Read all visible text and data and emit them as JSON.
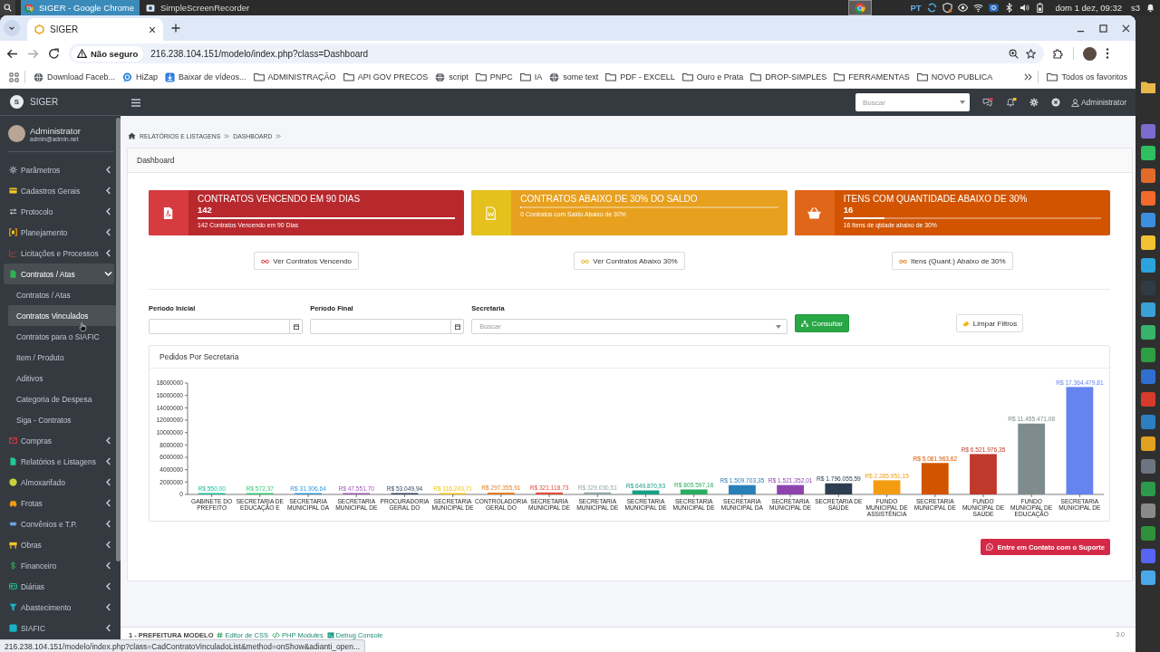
{
  "os_bar": {
    "windows": [
      {
        "label": "SIGER - Google Chrome",
        "selected": true
      },
      {
        "label": "SimpleScreenRecorder",
        "selected": false
      }
    ],
    "language": "PT",
    "clock": "dom 1 dez, 09:32",
    "workspace": "s3"
  },
  "browser": {
    "tabs": [
      {
        "label": "SIGER",
        "selected": true
      }
    ],
    "security": "Não seguro",
    "url": "216.238.104.151/modelo/index.php?class=Dashboard",
    "bookmarks": [
      {
        "kind": "globe",
        "label": "Download Faceb..."
      },
      {
        "kind": "chat",
        "label": "HiZap"
      },
      {
        "kind": "download",
        "label": "Baixar de vídeos..."
      },
      {
        "kind": "folder",
        "label": "ADMINISTRAÇÃO"
      },
      {
        "kind": "folder",
        "label": "API GOV PRECOS"
      },
      {
        "kind": "globe",
        "label": "script"
      },
      {
        "kind": "folder",
        "label": "PNPC"
      },
      {
        "kind": "folder",
        "label": "IA"
      },
      {
        "kind": "globe",
        "label": "some text"
      },
      {
        "kind": "folder",
        "label": "PDF - EXCELL"
      },
      {
        "kind": "folder",
        "label": "Ouro e Prata"
      },
      {
        "kind": "folder",
        "label": "DROP-SIMPLES"
      },
      {
        "kind": "folder",
        "label": "FERRAMENTAS"
      },
      {
        "kind": "folder",
        "label": "NOVO PUBLICA"
      }
    ],
    "all_bookmarks": "Todos os favoritos",
    "status_url": "216.238.104.151/modelo/index.php?class=CadContratoVinculadoList&method=onShow&adianti_open..."
  },
  "sidebar": {
    "brand": "SIGER",
    "brand_initial": "S",
    "user": {
      "name": "Administrator",
      "email": "admin@admin.net"
    },
    "menu": [
      {
        "label": "Parâmetros",
        "expanded": false
      },
      {
        "label": "Cadastros Gerais",
        "expanded": false
      },
      {
        "label": "Protocolo",
        "expanded": false
      },
      {
        "label": "Planejamento",
        "expanded": false
      },
      {
        "label": "Licitações e Processos",
        "expanded": false
      },
      {
        "label": "Contratos / Atas",
        "expanded": true,
        "children": [
          {
            "label": "Contratos / Atas",
            "selected": false
          },
          {
            "label": "Contratos Vinculados",
            "selected": true
          },
          {
            "label": "Contratos para o SIAFIC",
            "selected": false
          },
          {
            "label": "Item / Produto",
            "selected": false
          },
          {
            "label": "Aditivos",
            "selected": false
          },
          {
            "label": "Categoria de Despesa",
            "selected": false
          },
          {
            "label": "Siga - Contratos",
            "selected": false
          }
        ]
      },
      {
        "label": "Compras",
        "expanded": false
      },
      {
        "label": "Relatórios e Listagens",
        "expanded": false
      },
      {
        "label": "Almoxarifado",
        "expanded": false
      },
      {
        "label": "Frotas",
        "expanded": false
      },
      {
        "label": "Convênios e T.P.",
        "expanded": false
      },
      {
        "label": "Obras",
        "expanded": false
      },
      {
        "label": "Financeiro",
        "expanded": false
      },
      {
        "label": "Diárias",
        "expanded": false
      },
      {
        "label": "Abastecimento",
        "expanded": false
      },
      {
        "label": "SIAFIC",
        "expanded": false
      }
    ]
  },
  "topbar": {
    "search": {
      "placeholder": "Buscar"
    },
    "user": "Administrator"
  },
  "breadcrumb": [
    "RELATÓRIOS E LISTAGENS",
    "DASHBOARD"
  ],
  "panel": {
    "title": "Dashboard",
    "info_boxes": [
      {
        "title": "CONTRATOS VENCENDO EM 90 DIAS",
        "count": "142",
        "level": 1,
        "description": "142 Contratos Vencendo em 90 Dias",
        "color": "#b8292d",
        "action": "Ver Contratos Vencendo"
      },
      {
        "title": "CONTRATOS ABAIXO DE 30% DO SALDO",
        "level": 0,
        "description": "0 Contratos com Saldo Abaixo de 30%",
        "color": "#e8a01f",
        "action": "Ver Contratos Abaixo 30%"
      },
      {
        "title": "ITENS COM QUANTIDADE ABAIXO DE 30%",
        "count": "16",
        "level": 0.16,
        "description": "16 Itens de qtdade abaixo de 30%",
        "color": "#d25400",
        "action": "Itens (Quant.) Abaixo de 30%"
      }
    ],
    "filters": {
      "fields": [
        {
          "label": "Período Inicial",
          "kind": "date"
        },
        {
          "label": "Período Final",
          "kind": "date"
        },
        {
          "label": "Secretaria",
          "kind": "select",
          "placeholder": "Buscar"
        }
      ],
      "buttons": [
        {
          "label": "Consultar",
          "kind": "primary"
        },
        {
          "label": "Limpar Filtros",
          "kind": "default"
        }
      ]
    },
    "chart_card": {
      "chart_data": {
        "type": "bar",
        "title": "Pedidos Por Secretaria",
        "categories": [
          "GABINETE DO PREFEITO",
          "SECRETARIA DE EDUCAÇÃO E",
          "SECRETARIA MUNICIPAL DA",
          "SECRETARIA MUNICIPAL DE",
          "PROCURADORIA GERAL DO",
          "SECRETARIA MUNICIPAL DE",
          "CONTROLADORIA GERAL DO",
          "SECRETARIA MUNICIPAL DE",
          "SECRETARIA MUNICIPAL DE",
          "SECRETARIA MUNICIPAL DE",
          "SECRETARIA MUNICIPAL DE",
          "SECRETARIA MUNICIPAL DA",
          "SECRETARIA MUNICIPAL DE",
          "SECRETARIA DE SAÚDE",
          "FUNDO MUNICIPAL DE ASSISTÊNCIA",
          "SECRETARIA MUNICIPAL DE",
          "FUNDO MUNICIPAL DE SAÚDE",
          "FUNDO MUNICIPAL DE EDUCAÇÃO",
          "SECRETARIA MUNICIPAL DE"
        ],
        "series": [
          {
            "values": [
              550,
              572.37,
              31306.64,
              47551.7,
              53049.94,
              116243.71,
              297355.91,
              321118.73,
              329030.51,
              649870.93,
              805597.16,
              1509703.35,
              1521352.01,
              1796055.59,
              2285951.15,
              5081963.62,
              6521976.35,
              11455471.08,
              17364479.81
            ],
            "colors": [
              "#1abc9c",
              "#2ecc71",
              "#3498db",
              "#9b59b6",
              "#34495e",
              "#f1c40f",
              "#e67e22",
              "#e74c3c",
              "#95a5a6",
              "#16a085",
              "#27ae60",
              "#2980b9",
              "#8e44ad",
              "#2c3e50",
              "#f39c12",
              "#d35400",
              "#c0392b",
              "#7f8c8d",
              "#6584ef"
            ]
          }
        ],
        "ylim": [
          0,
          18000000
        ],
        "yticks": [
          0,
          2000000,
          4000000,
          6000000,
          8000000,
          10000000,
          12000000,
          14000000,
          16000000,
          18000000
        ],
        "value_labels": [
          "R$ 550,00",
          "R$ 572,37",
          "R$ 31.306,64",
          "R$ 47.551,70",
          "R$ 53.049,94",
          "R$ 116.243,71",
          "R$ 297.355,91",
          "R$ 321.118,73",
          "R$ 329.030,51",
          "R$ 649.870,93",
          "R$ 805.597,16",
          "R$ 1.509.703,35",
          "R$ 1.521.352,01",
          "R$ 1.796.055,59",
          "R$ 2.285.951,15",
          "R$ 5.081.963,62",
          "R$ 6.521.976,35",
          "R$ 11.455.471,08",
          "R$ 17.364.479,81"
        ]
      }
    },
    "support_button": "Entre em Contato com o Suporte"
  },
  "footer": {
    "company": "1 - PREFEITURA MODELO",
    "links": [
      "Editor de CSS",
      "PHP Modules",
      "Debug Console"
    ],
    "version": "3.0"
  }
}
